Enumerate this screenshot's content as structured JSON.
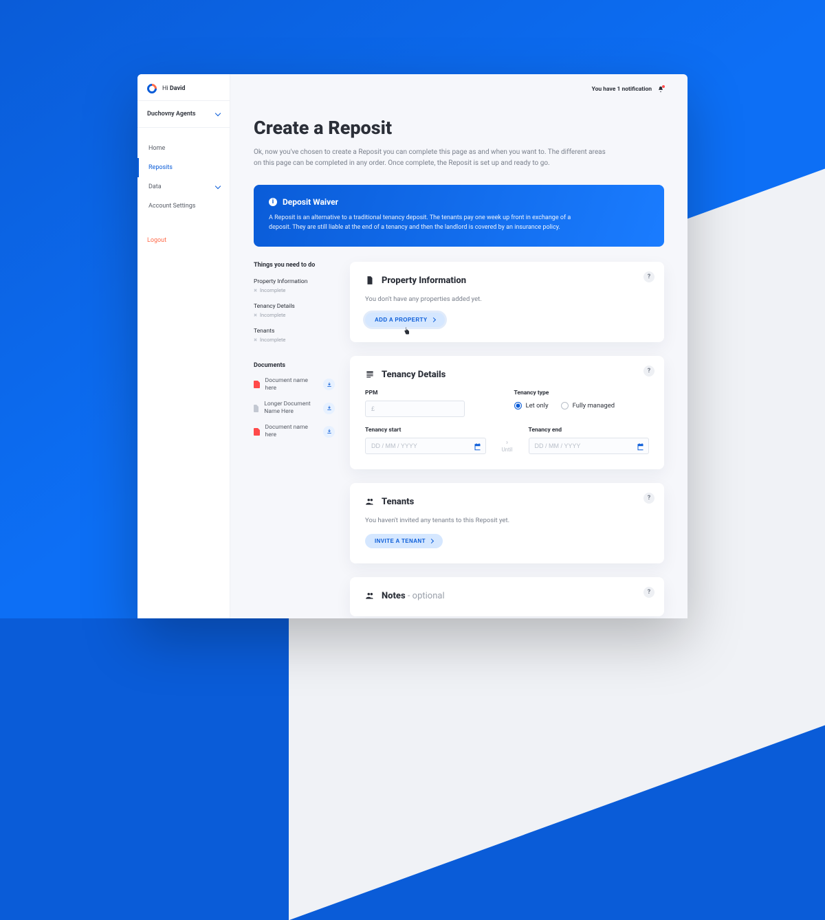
{
  "greeting": {
    "prefix": "Hi ",
    "name": "David"
  },
  "agency": "Duchovny Agents",
  "nav": {
    "home": "Home",
    "reposits": "Reposits",
    "data": "Data",
    "account": "Account Settings",
    "logout": "Logout"
  },
  "notification": "You have 1 notification",
  "page": {
    "title": "Create a Reposit",
    "lead": "Ok, now you've chosen to create a Reposit you can complete this page as and when you want to. The different areas on this page can be completed in any order. Once complete, the Reposit is set up and ready to go."
  },
  "banner": {
    "title": "Deposit Waiver",
    "body": "A Reposit is an alternative to a traditional tenancy deposit. The tenants pay one week up front in exchange of a deposit. They are still liable at the end of a tenancy and then the landlord is covered by an insurance policy."
  },
  "tasks": {
    "heading": "Things you need to do",
    "items": [
      {
        "name": "Property Information",
        "status": "Incomplete"
      },
      {
        "name": "Tenancy Details",
        "status": "Incomplete"
      },
      {
        "name": "Tenants",
        "status": "Incomplete"
      }
    ]
  },
  "documents": {
    "heading": "Documents",
    "items": [
      {
        "name": "Document name here"
      },
      {
        "name": "Longer Document Name Here"
      },
      {
        "name": "Document name here"
      }
    ]
  },
  "property": {
    "title": "Property Information",
    "empty": "You don't have any properties added yet.",
    "cta": "ADD A PROPERTY"
  },
  "tenancy": {
    "title": "Tenancy Details",
    "ppm_label": "PPM",
    "ppm_placeholder": "£",
    "type_label": "Tenancy type",
    "type_options": {
      "let_only": "Let only",
      "fully_managed": "Fully managed"
    },
    "start_label": "Tenancy start",
    "end_label": "Tenancy end",
    "date_placeholder": "DD / MM / YYYY",
    "until": "Until"
  },
  "tenants": {
    "title": "Tenants",
    "empty": "You haven't invited any tenants to this Reposit yet.",
    "cta": "INVITE A TENANT"
  },
  "notes": {
    "title": "Notes",
    "suffix": " - optional"
  },
  "help": "?"
}
